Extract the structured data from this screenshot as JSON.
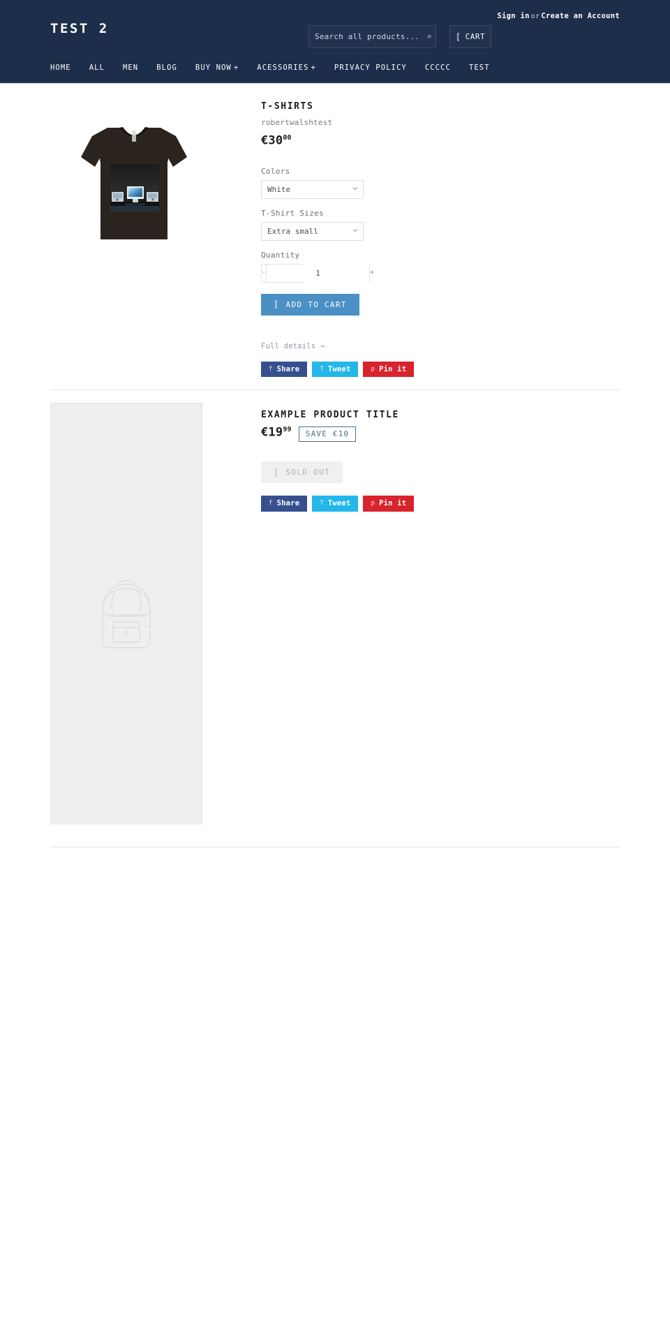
{
  "header": {
    "account": {
      "sign_in": "Sign in",
      "separator": "or",
      "create_account": "Create an Account"
    },
    "logo": "TEST 2",
    "search": {
      "placeholder": "Search all products...",
      "value": "",
      "submit_icon": "search-icon",
      "submit_glyph": "⌕"
    },
    "cart": {
      "label": "CART",
      "icon": "cart-icon",
      "icon_glyph": "["
    },
    "nav": [
      {
        "label": "HOME",
        "has_submenu": false
      },
      {
        "label": "ALL",
        "has_submenu": false
      },
      {
        "label": "MEN",
        "has_submenu": false
      },
      {
        "label": "BLOG",
        "has_submenu": false
      },
      {
        "label": "BUY NOW",
        "has_submenu": true,
        "submenu_glyph": "+"
      },
      {
        "label": "ACESSORIES",
        "has_submenu": true,
        "submenu_glyph": "+"
      },
      {
        "label": "PRIVACY POLICY",
        "has_submenu": false
      },
      {
        "label": "CCCCC",
        "has_submenu": false
      },
      {
        "label": "TEST",
        "has_submenu": false
      }
    ]
  },
  "products": [
    {
      "title": "T-SHIRTS",
      "vendor": "robertwalshtest",
      "price_main": "€30",
      "price_cents": "00",
      "image_alt": "black v-neck t-shirt with computer photo print",
      "options": [
        {
          "label": "Colors",
          "selected": "White",
          "choices": [
            "White"
          ]
        },
        {
          "label": "T-Shirt Sizes",
          "selected": "Extra small",
          "choices": [
            "Extra small"
          ]
        }
      ],
      "quantity": {
        "label": "Quantity",
        "value": "1",
        "decrement": "-",
        "increment": "+"
      },
      "add_to_cart": {
        "label": "ADD TO CART",
        "icon_glyph": "[",
        "disabled": false
      },
      "full_details": "Full details →",
      "share": [
        {
          "network": "facebook",
          "label": "Share",
          "glyph": "f",
          "color": "#36508f"
        },
        {
          "network": "twitter",
          "label": "Tweet",
          "glyph": "T",
          "color": "#23b7ea"
        },
        {
          "network": "pinterest",
          "label": "Pin it",
          "glyph": "p",
          "color": "#d9232d"
        }
      ]
    },
    {
      "title": "EXAMPLE PRODUCT TITLE",
      "price_main": "€19",
      "price_cents": "99",
      "save_badge": "SAVE €10",
      "image_alt": "backpack placeholder line drawing",
      "add_to_cart": {
        "label": "SOLD OUT",
        "icon_glyph": "[",
        "disabled": true
      },
      "share": [
        {
          "network": "facebook",
          "label": "Share",
          "glyph": "f",
          "color": "#36508f"
        },
        {
          "network": "twitter",
          "label": "Tweet",
          "glyph": "T",
          "color": "#23b7ea"
        },
        {
          "network": "pinterest",
          "label": "Pin it",
          "glyph": "p",
          "color": "#d9232d"
        }
      ]
    }
  ],
  "colors": {
    "header_bg": "#1c2e4a",
    "accent_button": "#4a90c4",
    "badge_border": "#4a6f8a",
    "placeholder_bg": "#efefef"
  }
}
